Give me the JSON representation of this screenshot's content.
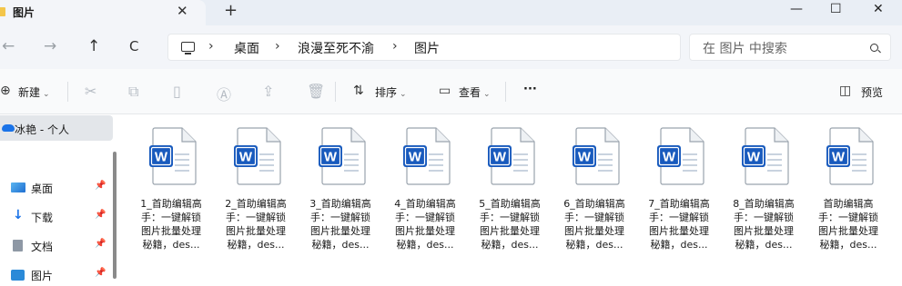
{
  "titlebar": {
    "tab_title": "图片",
    "tab_close": "✕",
    "new_tab": "+",
    "minimize": "—",
    "maximize": "☐",
    "close": "✕"
  },
  "nav": {
    "back": "←",
    "forward": "→",
    "up": "↑",
    "refresh": "C"
  },
  "address": {
    "separator": "›",
    "crumbs": [
      "桌面",
      "浪漫至死不渝",
      "图片"
    ]
  },
  "search": {
    "placeholder": "在 图片 中搜索"
  },
  "toolbar": {
    "new_label": "新建",
    "sort_label": "排序",
    "view_label": "查看",
    "more_label": "···",
    "preview_label": "预览"
  },
  "sidebar": {
    "items": [
      {
        "label": "冰艳 - 个人",
        "icon": "cloud-icon"
      },
      {
        "label": "桌面",
        "icon": "desktop-icon"
      },
      {
        "label": "下载",
        "icon": "download-icon"
      },
      {
        "label": "文档",
        "icon": "document-icon"
      },
      {
        "label": "图片",
        "icon": "pictures-icon"
      }
    ]
  },
  "files": [
    {
      "name": "1_首助编辑高\n手：一键解锁\n图片批量处理\n秘籍，des..."
    },
    {
      "name": "2_首助编辑高\n手：一键解锁\n图片批量处理\n秘籍，des..."
    },
    {
      "name": "3_首助编辑高\n手：一键解锁\n图片批量处理\n秘籍，des..."
    },
    {
      "name": "4_首助编辑高\n手：一键解锁\n图片批量处理\n秘籍，des..."
    },
    {
      "name": "5_首助编辑高\n手：一键解锁\n图片批量处理\n秘籍，des..."
    },
    {
      "name": "6_首助编辑高\n手：一键解锁\n图片批量处理\n秘籍，des..."
    },
    {
      "name": "7_首助编辑高\n手：一键解锁\n图片批量处理\n秘籍，des..."
    },
    {
      "name": "8_首助编辑高\n手：一键解锁\n图片批量处理\n秘籍，des..."
    },
    {
      "name": "首助编辑高\n手：一键解锁\n图片批量处理\n秘籍，des..."
    }
  ],
  "file_icon": {
    "letter": "W",
    "color": "#185abd"
  }
}
